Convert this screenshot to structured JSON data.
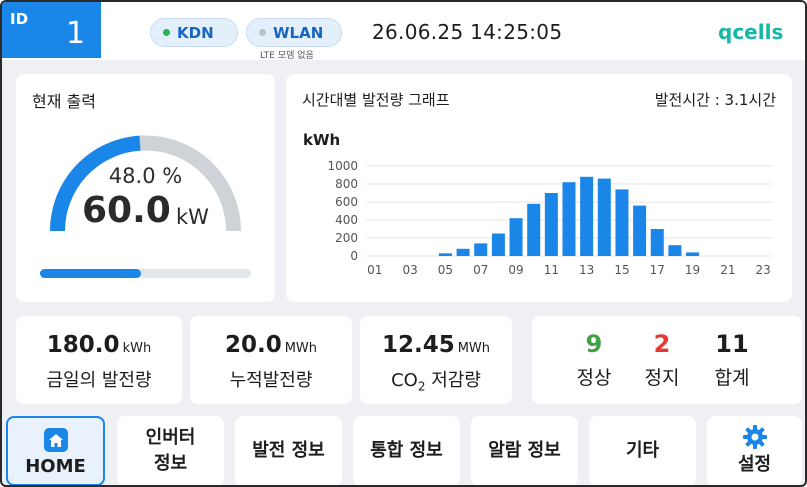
{
  "header": {
    "id_label": "ID",
    "id_value": "1",
    "kdn_label": "KDN",
    "wlan_label": "WLAN",
    "lte_note": "LTE 모뎀 없음",
    "datetime": "26.06.25  14:25:05",
    "logo_text": "qcells",
    "colors": {
      "accent": "#1a86e8",
      "kdn_dot": "#2db159",
      "wlan_dot": "#b9c0c8",
      "logo": "#14b8a6"
    }
  },
  "power": {
    "title": "현재 출력",
    "percent_text": "48.0 %",
    "percent_value": 48.0,
    "value": "60.0",
    "unit": "kW"
  },
  "chart": {
    "title": "시간대별 발전량 그래프",
    "gen_time": "발전시간 : 3.1시간",
    "unit": "kWh"
  },
  "chart_data": {
    "type": "bar",
    "categories": [
      "01",
      "02",
      "03",
      "04",
      "05",
      "06",
      "07",
      "08",
      "09",
      "10",
      "11",
      "12",
      "13",
      "14",
      "15",
      "16",
      "17",
      "18",
      "19",
      "20",
      "21",
      "22",
      "23"
    ],
    "tick_labels": [
      "01",
      "03",
      "05",
      "07",
      "09",
      "11",
      "13",
      "15",
      "17",
      "19",
      "21",
      "23"
    ],
    "y_ticks": [
      1000,
      800,
      600,
      400,
      200,
      0
    ],
    "values": [
      0,
      0,
      0,
      0,
      30,
      80,
      140,
      250,
      420,
      580,
      700,
      820,
      880,
      860,
      740,
      560,
      300,
      120,
      40,
      0,
      0,
      0,
      0
    ],
    "ylabel": "kWh",
    "ylim": [
      0,
      1000
    ],
    "grid": true,
    "bar_color": "#1a86e8"
  },
  "stats": {
    "today": {
      "value": "180.0",
      "unit": "kWh",
      "label": "금일의 발전량"
    },
    "total": {
      "value": "20.0",
      "unit": "MWh",
      "label": "누적발전량"
    },
    "co2": {
      "value": "12.45",
      "unit": "MWh",
      "label_pre": "CO",
      "label_sub": "2",
      "label_post": " 저감량"
    },
    "inverters": {
      "normal": {
        "value": "9",
        "label": "정상",
        "color": "#43a047"
      },
      "stopped": {
        "value": "2",
        "label": "정지",
        "color": "#e53935"
      },
      "total": {
        "value": "11",
        "label": "합계"
      }
    }
  },
  "nav": {
    "home": "HOME",
    "inverter_line1": "인버터",
    "inverter_line2": "정보",
    "generation": "발전 정보",
    "integrated": "통합 정보",
    "alarm": "알람 정보",
    "etc": "기타",
    "settings": "설정"
  }
}
